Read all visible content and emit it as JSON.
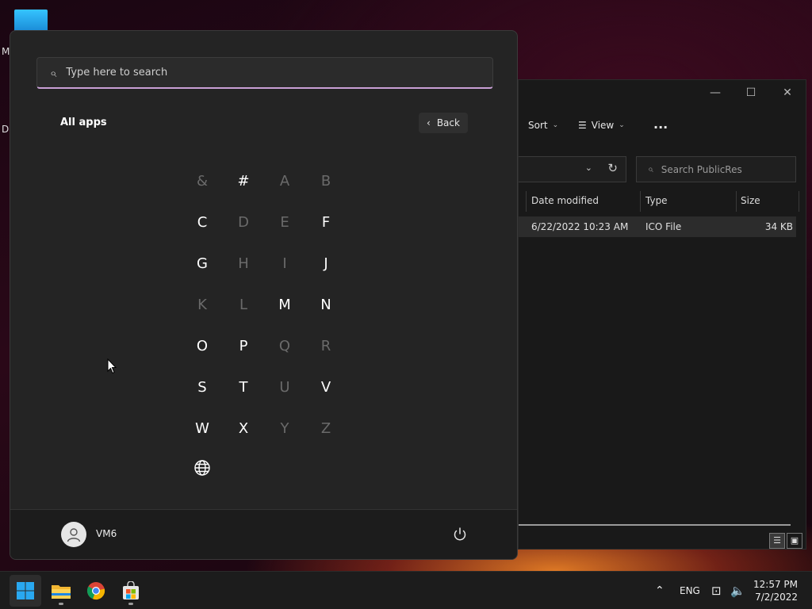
{
  "desktop": {
    "letters": [
      "M",
      "Da"
    ]
  },
  "explorer": {
    "controls": {
      "minimize": "—",
      "maximize": "☐",
      "close": "✕"
    },
    "toolbar": {
      "sort_label": "Sort",
      "view_label": "View",
      "more_label": "···"
    },
    "search_placeholder": "Search PublicRes",
    "columns": {
      "date_modified": "Date modified",
      "type": "Type",
      "size": "Size"
    },
    "file": {
      "date_modified": "6/22/2022 10:23 AM",
      "type": "ICO File",
      "size": "34 KB"
    }
  },
  "start_menu": {
    "search_placeholder": "Type here to search",
    "title": "All apps",
    "back_label": "Back",
    "letters": [
      {
        "char": "&",
        "enabled": false
      },
      {
        "char": "#",
        "enabled": true
      },
      {
        "char": "A",
        "enabled": false
      },
      {
        "char": "B",
        "enabled": false
      },
      {
        "char": "C",
        "enabled": true
      },
      {
        "char": "D",
        "enabled": false
      },
      {
        "char": "E",
        "enabled": false
      },
      {
        "char": "F",
        "enabled": true
      },
      {
        "char": "G",
        "enabled": true
      },
      {
        "char": "H",
        "enabled": false
      },
      {
        "char": "I",
        "enabled": false
      },
      {
        "char": "J",
        "enabled": true
      },
      {
        "char": "K",
        "enabled": false
      },
      {
        "char": "L",
        "enabled": false
      },
      {
        "char": "M",
        "enabled": true
      },
      {
        "char": "N",
        "enabled": true
      },
      {
        "char": "O",
        "enabled": true
      },
      {
        "char": "P",
        "enabled": true
      },
      {
        "char": "Q",
        "enabled": false
      },
      {
        "char": "R",
        "enabled": false
      },
      {
        "char": "S",
        "enabled": true
      },
      {
        "char": "T",
        "enabled": true
      },
      {
        "char": "U",
        "enabled": false
      },
      {
        "char": "V",
        "enabled": true
      },
      {
        "char": "W",
        "enabled": true
      },
      {
        "char": "X",
        "enabled": true
      },
      {
        "char": "Y",
        "enabled": false
      },
      {
        "char": "Z",
        "enabled": false
      }
    ],
    "globe_icon": "globe-icon",
    "user": {
      "name": "VM6"
    }
  },
  "taskbar": {
    "apps": [
      "windows-start",
      "file-explorer",
      "chrome",
      "microsoft-store"
    ],
    "tray": {
      "language": "ENG"
    },
    "clock": {
      "time": "12:57 PM",
      "date": "7/2/2022"
    }
  },
  "colors": {
    "accent_underline": "#c9a0d6",
    "enabled_letter": "#ffffff",
    "disabled_letter": "#6a6a6a"
  }
}
